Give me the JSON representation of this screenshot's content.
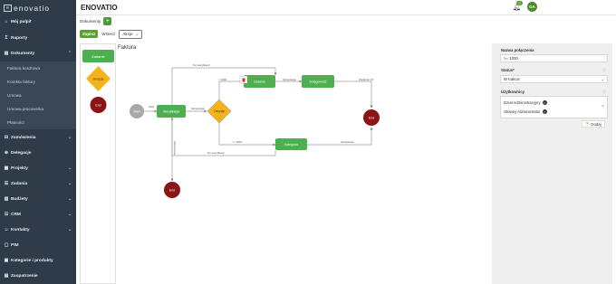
{
  "sidebar": {
    "logo": "enovatio",
    "items": [
      {
        "label": "Mój pulpit",
        "icon": "home-icon",
        "glyph": "⌂"
      },
      {
        "label": "Raporty",
        "icon": "sigma-icon",
        "glyph": "Σ"
      },
      {
        "label": "Dokumenty",
        "icon": "document-icon",
        "glyph": "▤"
      },
      {
        "label": "Zamówienia",
        "icon": "cart-icon",
        "glyph": "⊟"
      },
      {
        "label": "Delegacje",
        "icon": "globe-icon",
        "glyph": "⊕"
      },
      {
        "label": "Projekty",
        "icon": "folder-icon",
        "glyph": "▦"
      },
      {
        "label": "Zadania",
        "icon": "tasks-icon",
        "glyph": "☰"
      },
      {
        "label": "Budżety",
        "icon": "budget-icon",
        "glyph": "▥"
      },
      {
        "label": "CRM",
        "icon": "crm-icon",
        "glyph": "☷"
      },
      {
        "label": "Kontakty",
        "icon": "contacts-icon",
        "glyph": "☺"
      },
      {
        "label": "PIM",
        "icon": "pim-icon",
        "glyph": "▢"
      },
      {
        "label": "Kategorie i produkty",
        "icon": "category-icon",
        "glyph": "▣"
      },
      {
        "label": "Zaopatrzenie",
        "icon": "supply-icon",
        "glyph": "▤"
      }
    ],
    "subitems": [
      "Faktura kosztowa",
      "Korekta faktury",
      "Umowa",
      "Umowa pracownika",
      "Płatności"
    ]
  },
  "header": {
    "title": "ENOVATIO",
    "bell_count": "0",
    "avatar": "GA"
  },
  "breadcrumb": {
    "label": "Dokumenty",
    "add": "+"
  },
  "toolbar": {
    "save": "Zapisz",
    "back": "Wstecz",
    "actions": "Akcje",
    "actions_chev": "⌄"
  },
  "palette": {
    "step": "Zadanie",
    "decision": "Decyzja",
    "end": "End"
  },
  "diagram": {
    "title": "Faktura",
    "start": "Start",
    "node_weryfikacja": "Weryfikacja",
    "node_decyzja": "Decyzja",
    "node_zadanie": "Zadanie",
    "node_ksiegowosc": "Księgowość",
    "node_kategoria": "Kategoria",
    "end": "End",
    "lbl_do_weryfikacji_top": "Do weryfikacji",
    "lbl_do_weryfikacji_bottom": "Do weryfikacji",
    "lbl_gt1000": "> 1000",
    "lbl_le1000": "<= 1000",
    "lbl_akceptacja1": "Akceptacja",
    "lbl_akceptacja2": "Akceptacja",
    "lbl_akceptacja3": "Akceptacja",
    "lbl_wyslij": "Wyślij do FK",
    "lbl_start": "Start",
    "lbl_odrzucenie": "Odrzucenie"
  },
  "props": {
    "condition_label": "Nazwa połączenia",
    "condition_value": ">= 1000",
    "status_label": "Status*",
    "status_value": "W trakcie",
    "users_label": "Użytkownicy",
    "users": [
      "Dział Administracyjny",
      "Główny Administrator"
    ],
    "add": "Dodaj",
    "info": "ⓘ"
  },
  "colors": {
    "sidebar": "#2f3b48",
    "green": "#5aa02c",
    "node_green": "#4caf50",
    "diamond": "#f5b21b",
    "end": "#8b1414",
    "start": "#a8a8a8"
  }
}
